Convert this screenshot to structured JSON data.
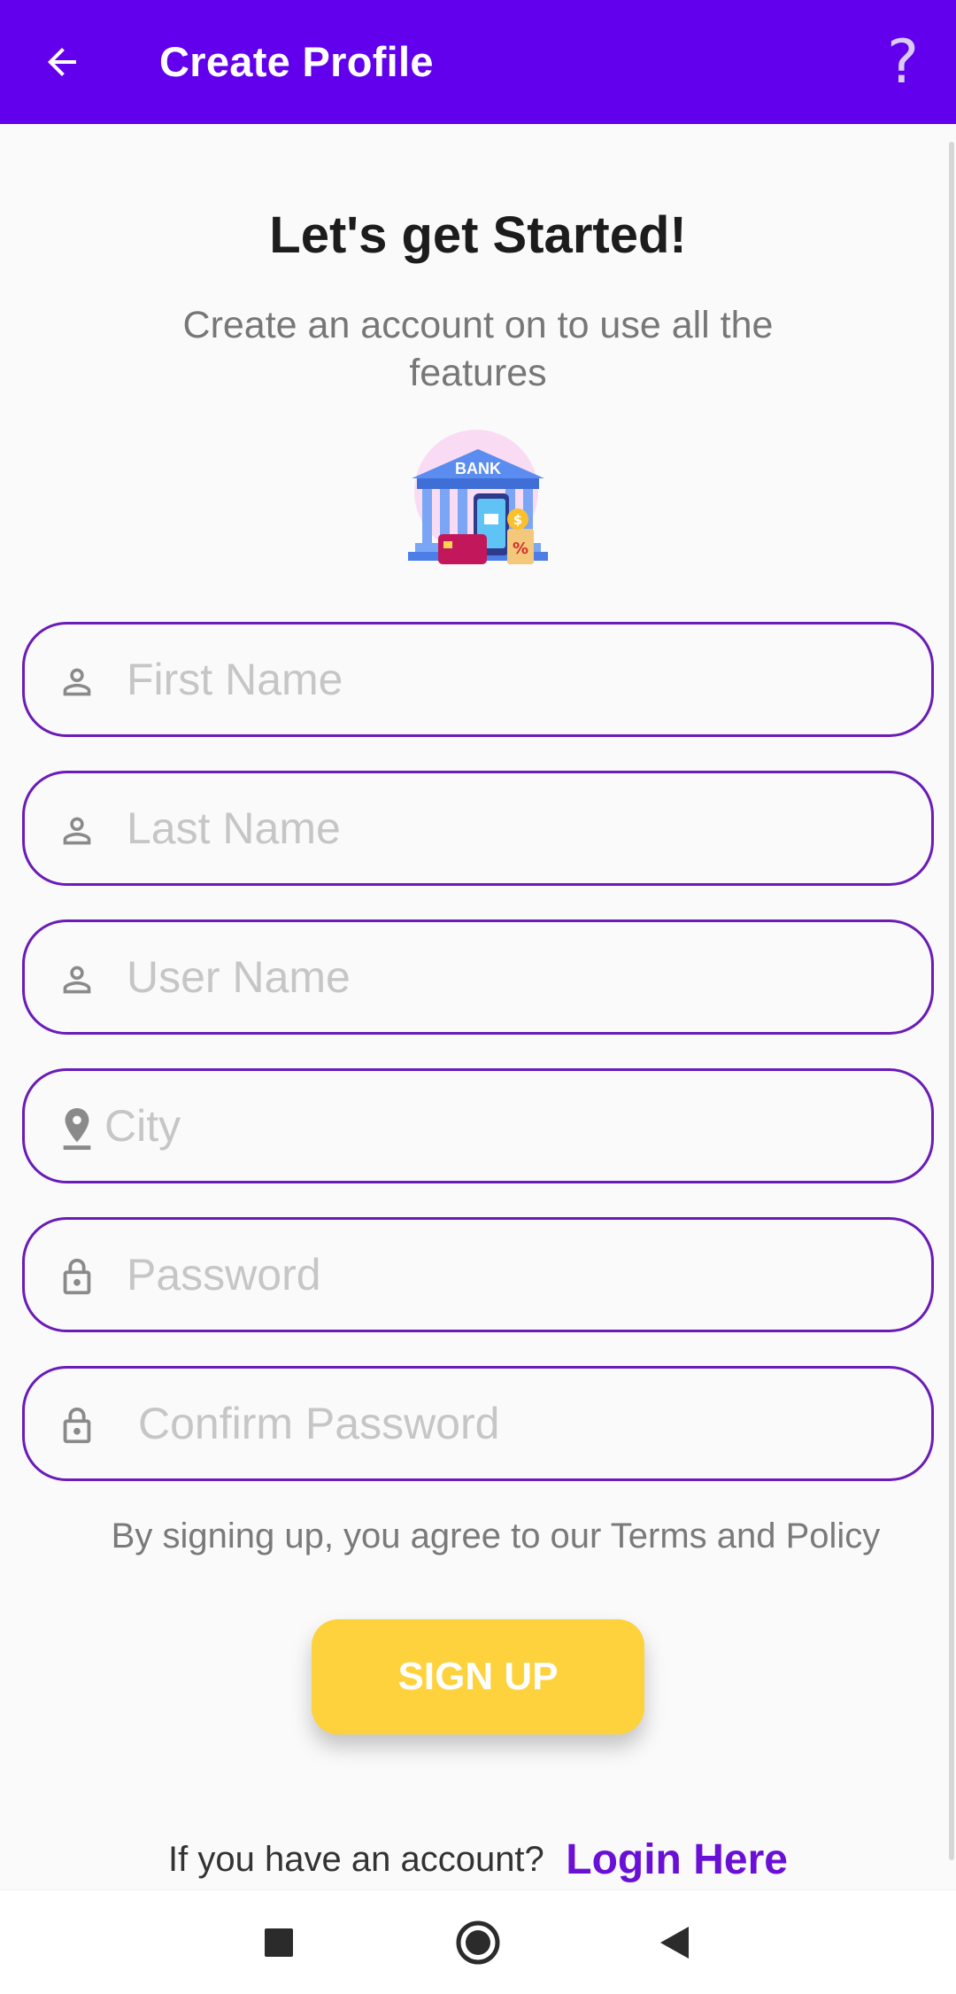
{
  "appbar": {
    "title": "Create Profile",
    "back_icon": "arrow-left-icon",
    "help_label": "?"
  },
  "header": {
    "heading": "Let's get Started!",
    "subheading": "Create an account on to use all the features",
    "illustration_label": "BANK"
  },
  "form": {
    "fields": [
      {
        "placeholder": "First Name",
        "icon": "person-icon"
      },
      {
        "placeholder": "Last Name",
        "icon": "person-icon"
      },
      {
        "placeholder": "User Name",
        "icon": "person-icon"
      },
      {
        "placeholder": "City",
        "icon": "location-pin-icon"
      },
      {
        "placeholder": "Password",
        "icon": "lock-icon"
      },
      {
        "placeholder": "Confirm Password",
        "icon": "lock-icon"
      }
    ],
    "terms": "By signing up, you agree to our Terms and Policy",
    "signup_label": "SIGN UP"
  },
  "footer": {
    "question": "If you have an account?",
    "login_label": "Login Here"
  },
  "colors": {
    "primary": "#6200ee",
    "field_border": "#6a1bb8",
    "button": "#fdd23c",
    "link": "#6a10d6"
  }
}
